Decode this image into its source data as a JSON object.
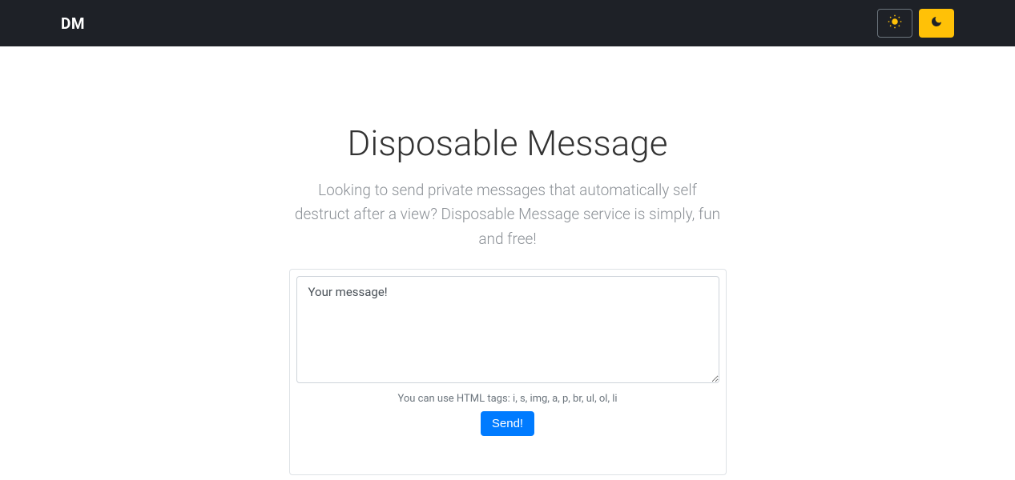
{
  "navbar": {
    "brand": "DM"
  },
  "main": {
    "title": "Disposable Message",
    "subtitle": "Looking to send private messages that automatically self destruct after a view? Disposable Message service is simply, fun and free!",
    "textarea_placeholder": "Your message!",
    "help_text": "You can use HTML tags: i, s, img, a, p, br, ul, ol, li",
    "send_label": "Send!"
  }
}
